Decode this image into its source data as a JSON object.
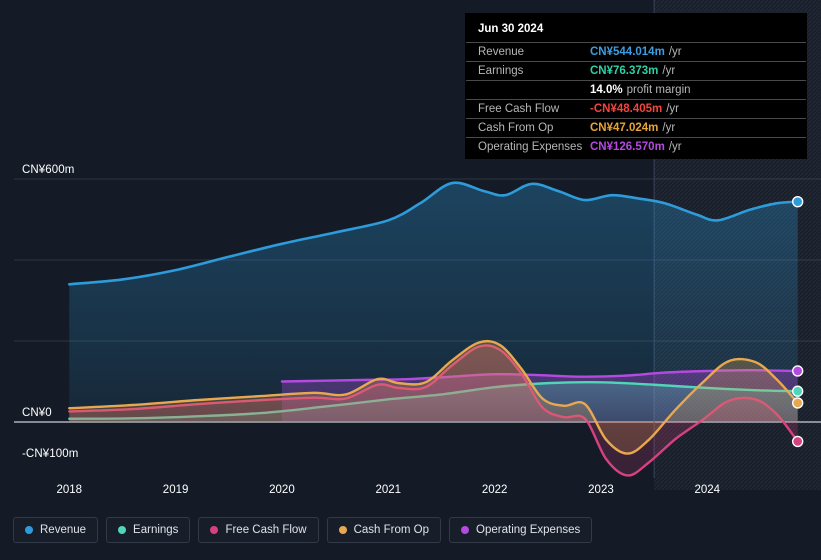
{
  "chart_data": {
    "type": "area",
    "title": "",
    "xlabel": "",
    "ylabel": "",
    "currency": "CN¥",
    "x_ticks": [
      "2018",
      "2019",
      "2020",
      "2021",
      "2022",
      "2023",
      "2024"
    ],
    "y_ticks": [
      "CN¥600m",
      "CN¥0",
      "-CN¥100m"
    ],
    "ylim": [
      -150,
      650
    ],
    "xlim": [
      2017.8,
      2024.9
    ],
    "grid": true,
    "legend_position": "bottom-left",
    "forecast_divider_x": "2023.5",
    "series": [
      {
        "name": "Revenue",
        "color": "#2e9bdb",
        "points": [
          [
            2018.0,
            340
          ],
          [
            2018.5,
            352
          ],
          [
            2019.0,
            375
          ],
          [
            2019.5,
            408
          ],
          [
            2020.0,
            440
          ],
          [
            2020.5,
            468
          ],
          [
            2021.0,
            498
          ],
          [
            2021.3,
            540
          ],
          [
            2021.6,
            590
          ],
          [
            2021.9,
            570
          ],
          [
            2022.1,
            560
          ],
          [
            2022.35,
            588
          ],
          [
            2022.6,
            570
          ],
          [
            2022.85,
            548
          ],
          [
            2023.1,
            560
          ],
          [
            2023.35,
            552
          ],
          [
            2023.6,
            540
          ],
          [
            2023.9,
            512
          ],
          [
            2024.1,
            498
          ],
          [
            2024.4,
            524
          ],
          [
            2024.65,
            540
          ],
          [
            2024.85,
            544
          ]
        ]
      },
      {
        "name": "Earnings",
        "color": "#4fd6b8",
        "points": [
          [
            2018.0,
            8
          ],
          [
            2018.6,
            9
          ],
          [
            2019.2,
            14
          ],
          [
            2019.8,
            22
          ],
          [
            2020.4,
            38
          ],
          [
            2021.0,
            56
          ],
          [
            2021.5,
            68
          ],
          [
            2022.0,
            86
          ],
          [
            2022.5,
            96
          ],
          [
            2023.0,
            98
          ],
          [
            2023.5,
            92
          ],
          [
            2024.0,
            84
          ],
          [
            2024.5,
            78
          ],
          [
            2024.85,
            76
          ]
        ]
      },
      {
        "name": "Free Cash Flow",
        "color": "#d6417f",
        "points": [
          [
            2018.0,
            26
          ],
          [
            2018.6,
            32
          ],
          [
            2019.2,
            44
          ],
          [
            2019.8,
            54
          ],
          [
            2020.3,
            60
          ],
          [
            2020.6,
            58
          ],
          [
            2020.9,
            92
          ],
          [
            2021.1,
            84
          ],
          [
            2021.35,
            86
          ],
          [
            2021.6,
            140
          ],
          [
            2021.85,
            186
          ],
          [
            2022.05,
            178
          ],
          [
            2022.25,
            120
          ],
          [
            2022.45,
            36
          ],
          [
            2022.65,
            12
          ],
          [
            2022.85,
            8
          ],
          [
            2023.05,
            -92
          ],
          [
            2023.25,
            -132
          ],
          [
            2023.45,
            -100
          ],
          [
            2023.7,
            -42
          ],
          [
            2023.95,
            4
          ],
          [
            2024.2,
            52
          ],
          [
            2024.45,
            56
          ],
          [
            2024.65,
            20
          ],
          [
            2024.85,
            -48
          ]
        ]
      },
      {
        "name": "Cash From Op",
        "color": "#e8a84f",
        "points": [
          [
            2018.0,
            34
          ],
          [
            2018.6,
            42
          ],
          [
            2019.2,
            54
          ],
          [
            2019.8,
            64
          ],
          [
            2020.3,
            72
          ],
          [
            2020.6,
            68
          ],
          [
            2020.9,
            106
          ],
          [
            2021.1,
            96
          ],
          [
            2021.35,
            98
          ],
          [
            2021.6,
            152
          ],
          [
            2021.85,
            196
          ],
          [
            2022.05,
            190
          ],
          [
            2022.25,
            132
          ],
          [
            2022.45,
            58
          ],
          [
            2022.65,
            40
          ],
          [
            2022.85,
            44
          ],
          [
            2023.05,
            -44
          ],
          [
            2023.25,
            -78
          ],
          [
            2023.45,
            -44
          ],
          [
            2023.7,
            30
          ],
          [
            2023.95,
            96
          ],
          [
            2024.2,
            150
          ],
          [
            2024.45,
            148
          ],
          [
            2024.65,
            106
          ],
          [
            2024.85,
            47
          ]
        ]
      },
      {
        "name": "Operating Expenses",
        "color": "#b44ae0",
        "points": [
          [
            2020.0,
            100
          ],
          [
            2020.4,
            102
          ],
          [
            2020.8,
            104
          ],
          [
            2021.2,
            106
          ],
          [
            2021.6,
            112
          ],
          [
            2022.0,
            118
          ],
          [
            2022.4,
            116
          ],
          [
            2022.8,
            112
          ],
          [
            2023.2,
            114
          ],
          [
            2023.6,
            122
          ],
          [
            2024.0,
            126
          ],
          [
            2024.4,
            128
          ],
          [
            2024.85,
            126
          ]
        ]
      }
    ]
  },
  "tooltip": {
    "date": "Jun 30 2024",
    "rows": [
      {
        "label": "Revenue",
        "value": "CN¥544.014m",
        "unit": "/yr",
        "color": "#3c9ee0",
        "sub": ""
      },
      {
        "label": "Earnings",
        "value": "CN¥76.373m",
        "unit": "/yr",
        "color": "#2fd0a8",
        "sub": ""
      },
      {
        "label": "",
        "value": "14.0%",
        "unit": "",
        "color": "#ffffff",
        "sub": "profit margin"
      },
      {
        "label": "Free Cash Flow",
        "value": "-CN¥48.405m",
        "unit": "/yr",
        "color": "#f2453d",
        "sub": ""
      },
      {
        "label": "Cash From Op",
        "value": "CN¥47.024m",
        "unit": "/yr",
        "color": "#e8a437",
        "sub": ""
      },
      {
        "label": "Operating Expenses",
        "value": "CN¥126.570m",
        "unit": "/yr",
        "color": "#b44ae0",
        "sub": ""
      }
    ]
  },
  "legend": {
    "items": [
      {
        "label": "Revenue",
        "color": "#2e9bdb"
      },
      {
        "label": "Earnings",
        "color": "#4fd6b8"
      },
      {
        "label": "Free Cash Flow",
        "color": "#d6417f"
      },
      {
        "label": "Cash From Op",
        "color": "#e8a84f"
      },
      {
        "label": "Operating Expenses",
        "color": "#b44ae0"
      }
    ]
  },
  "axis": {
    "y_labels": [
      {
        "text": "CN¥600m",
        "value": 600
      },
      {
        "text": "CN¥0",
        "value": 0
      },
      {
        "text": "-CN¥100m",
        "value": -100
      }
    ],
    "x_labels": [
      "2018",
      "2019",
      "2020",
      "2021",
      "2022",
      "2023",
      "2024"
    ]
  },
  "theme": {
    "background": "#141b26",
    "grid": "#2b3442",
    "zero_line": "#c9ccd1",
    "tooltip_bg": "#000000"
  }
}
